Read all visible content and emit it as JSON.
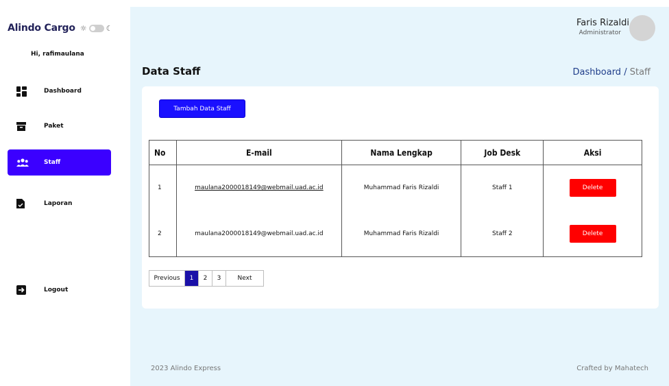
{
  "sidebar": {
    "brand": "Alindo Cargo",
    "theme_sun": "☼",
    "theme_moon": "☾",
    "greeting": "Hi, rafimaulana",
    "items": [
      {
        "label": "Dashboard",
        "icon": "dashboard-icon"
      },
      {
        "label": "Paket",
        "icon": "box-icon"
      },
      {
        "label": "Staff",
        "icon": "users-icon"
      },
      {
        "label": "Laporan",
        "icon": "document-icon"
      },
      {
        "label": "Logout",
        "icon": "logout-icon"
      }
    ]
  },
  "header": {
    "user_name": "Faris Rizaldi",
    "user_role": "Administrator"
  },
  "page": {
    "title": "Data Staff",
    "breadcrumb_parent": "Dashboard",
    "breadcrumb_sep": " / ",
    "breadcrumb_current": "Staff"
  },
  "actions": {
    "add_staff": "Tambah Data Staff"
  },
  "table": {
    "headers": [
      "No",
      "E-mail",
      "Nama Lengkap",
      "Job Desk",
      "Aksi"
    ],
    "rows": [
      {
        "no": "1",
        "email": "maulana2000018149@webmail.uad.ac.id",
        "name": "Muhammad Faris Rizaldi",
        "job": "Staff 1",
        "action": "Delete"
      },
      {
        "no": "2",
        "email": "maulana2000018149@webmail.uad.ac.id",
        "name": "Muhammad Faris Rizaldi",
        "job": "Staff 2",
        "action": "Delete"
      }
    ]
  },
  "pagination": {
    "previous": "Previous",
    "pages": [
      "1",
      "2",
      "3"
    ],
    "next": "Next",
    "current": "1"
  },
  "footer": {
    "left": "2023 Alindo Express",
    "right": "Crafted by Mahatech"
  },
  "colors": {
    "accent": "#3b00ff",
    "delete": "#ff0000",
    "main_bg": "#e7f5fc"
  }
}
